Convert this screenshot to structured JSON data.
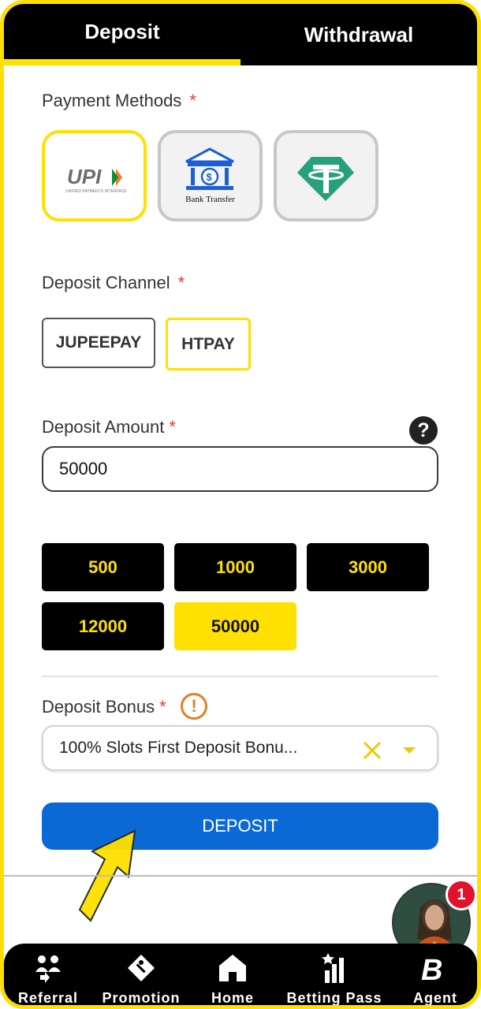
{
  "tabs": {
    "deposit": "Deposit",
    "withdrawal": "Withdrawal"
  },
  "payment_methods": {
    "label": "Payment Methods",
    "required_mark": "*",
    "options": [
      {
        "name": "UPI",
        "subtitle": "UNIFIED PAYMENTS INTERFACE",
        "selected": true
      },
      {
        "name": "Bank Transfer",
        "selected": false
      },
      {
        "name": "USDT",
        "selected": false
      }
    ]
  },
  "deposit_channel": {
    "label": "Deposit Channel",
    "required_mark": "*",
    "options": [
      "JUPEEPAY",
      "HTPAY"
    ],
    "selected": "HTPAY"
  },
  "deposit_amount": {
    "label": "Deposit Amount",
    "required_mark": "*",
    "value": "50000",
    "help_icon": "question-circle-icon",
    "presets": [
      "500",
      "1000",
      "3000",
      "12000",
      "50000"
    ],
    "selected_preset": "50000"
  },
  "deposit_bonus": {
    "label": "Deposit Bonus",
    "required_mark": "*",
    "info_icon": "exclamation-circle-icon",
    "selected_text": "100% Slots First Deposit Bonu...",
    "clear_icon": "close-icon",
    "dropdown_icon": "caret-down-icon"
  },
  "deposit_button": "DEPOSIT",
  "floating": {
    "badge_count": "1"
  },
  "bottom_nav": {
    "items": [
      {
        "label": "Referral",
        "icon": "referral-icon"
      },
      {
        "label": "Promotion",
        "icon": "gift-tag-icon"
      },
      {
        "label": "Home",
        "icon": "home-icon"
      },
      {
        "label": "Betting Pass",
        "icon": "bar-chart-star-icon"
      },
      {
        "label": "Agent",
        "icon": "agent-logo-icon"
      }
    ]
  },
  "colors": {
    "accent_yellow": "#ffe000",
    "primary_blue": "#0b69d6",
    "nav_black": "#000000",
    "required_red": "#e53935",
    "info_orange": "#e67e22",
    "tether_green": "#26a17b"
  }
}
